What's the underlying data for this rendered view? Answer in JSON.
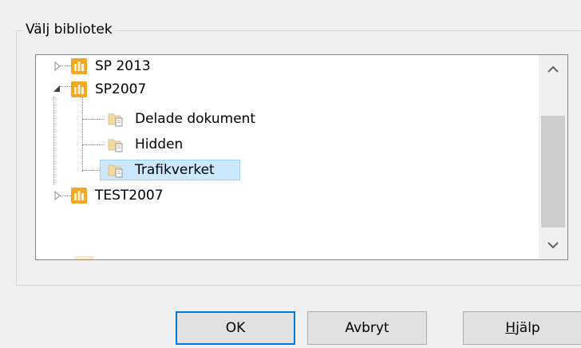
{
  "dialog": {
    "group_title": "Välj bibliotek"
  },
  "tree": {
    "nodes": [
      {
        "label": "SP 2013",
        "expanded": false,
        "icon": "site-collection-icon"
      },
      {
        "label": "SP2007",
        "expanded": true,
        "icon": "site-collection-icon"
      },
      {
        "label": "Delade dokument",
        "icon": "document-library-icon"
      },
      {
        "label": "Hidden",
        "icon": "document-library-icon"
      },
      {
        "label": "Trafikverket",
        "icon": "document-library-icon",
        "selected": true
      },
      {
        "label": "TEST2007",
        "expanded": false,
        "icon": "site-collection-icon"
      }
    ]
  },
  "buttons": {
    "ok": "OK",
    "cancel": "Avbryt",
    "help_mnemonic": "H",
    "help_rest": "jälp"
  },
  "colors": {
    "selection_fill": "#cce8ff",
    "selection_border": "#99d1ff",
    "default_button_border": "#0078d7",
    "site_icon_orange": "#f5a623"
  }
}
